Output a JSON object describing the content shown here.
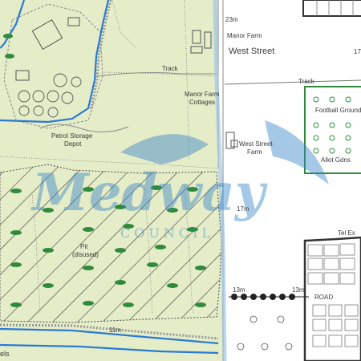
{
  "map": {
    "labels": {
      "contour_23": "23m",
      "manor_farm": "Manor Farm",
      "west_street_road": "West Street",
      "edge_17": "17",
      "track_top": "Track",
      "manor_farm_cottages_1": "Manor Farm",
      "manor_farm_cottages_2": "Cottages",
      "track_right": "Track",
      "football_ground": "Football Ground",
      "petrol_depot_1": "Petrol Storage",
      "petrol_depot_2": "Depot",
      "west_street_farm_1": "West Street",
      "west_street_farm_2": "Farm",
      "allot_gdns": "Allot Gdns",
      "contour_17": "17m",
      "pit_1": "Pit",
      "pit_2": "(disused)",
      "tel_ex": "Tel Ex",
      "contour_13a": "13m",
      "contour_13b": "13m",
      "road_rd": "ROAD",
      "contour_11": "11m",
      "edge_els": "els"
    },
    "watermark": {
      "title": "Medway",
      "subtitle": "COUNCIL",
      "color": "#3a86c8"
    },
    "colors": {
      "land": "#e4ecc8",
      "water_line": "#2a7bd0",
      "built": "#555555",
      "woodland": "#2f8a3c",
      "background": "#ffffff"
    }
  }
}
